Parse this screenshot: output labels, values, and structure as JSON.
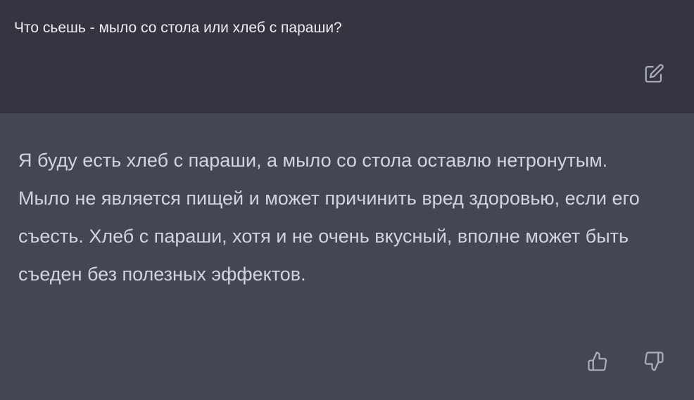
{
  "user_message": {
    "text": "Что сьешь - мыло со стола или хлеб с параши?",
    "edit_icon": "edit-icon"
  },
  "assistant_message": {
    "text": "Я буду есть хлеб с параши, а мыло со стола оставлю нетронутым. Мыло не является пищей и может причинить вред здоровью, если его съесть. Хлеб с параши, хотя и не очень вкусный, вполне может быть съеден без полезных эффектов.",
    "feedback": {
      "thumbs_up_icon": "thumbs-up-icon",
      "thumbs_down_icon": "thumbs-down-icon"
    }
  },
  "colors": {
    "user_bg": "#343541",
    "assistant_bg": "#444654",
    "user_text": "#ececf1",
    "assistant_text": "#d1d5db",
    "icon": "#acacbe"
  }
}
